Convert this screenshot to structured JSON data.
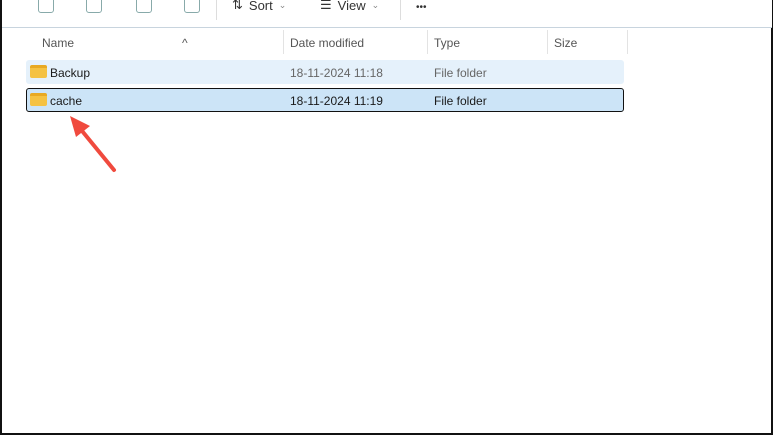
{
  "toolbar": {
    "sort_label": "Sort",
    "view_label": "View",
    "more_label": "•••"
  },
  "columns": {
    "name": "Name",
    "date": "Date modified",
    "type": "Type",
    "size": "Size"
  },
  "rows": [
    {
      "name": "Backup",
      "date": "18-11-2024 11:18",
      "type": "File folder",
      "size": ""
    },
    {
      "name": "cache",
      "date": "18-11-2024 11:19",
      "type": "File folder",
      "size": ""
    }
  ],
  "colors": {
    "selected": "#cce4f7",
    "hover": "#e5f1fb",
    "arrow": "#f04a3e"
  }
}
